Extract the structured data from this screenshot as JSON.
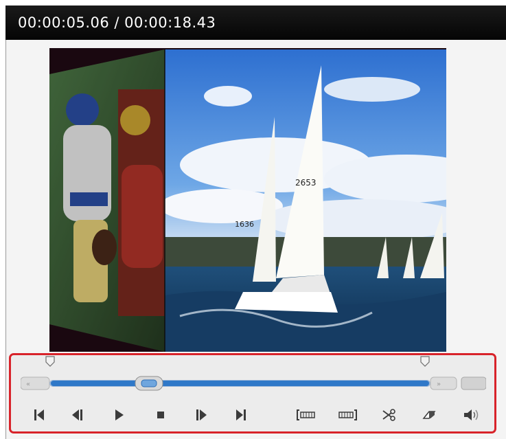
{
  "player": {
    "time_display": "00:00:05.06 / 00:00:18.43",
    "progress": 0.26,
    "mark_in": 0.06,
    "mark_out": 0.93
  },
  "preview": {
    "sail_numbers": [
      "2653",
      "1636"
    ]
  },
  "controls": {
    "buttons": [
      "go-to-start",
      "previous-frame",
      "play",
      "stop",
      "next-frame",
      "go-to-end",
      "mark-in",
      "mark-out",
      "split-clip",
      "eraser",
      "volume"
    ]
  },
  "colors": {
    "highlight_border": "#d8232a",
    "track_fill": "#2f78c8",
    "title_bar": "#0b0b0b"
  }
}
